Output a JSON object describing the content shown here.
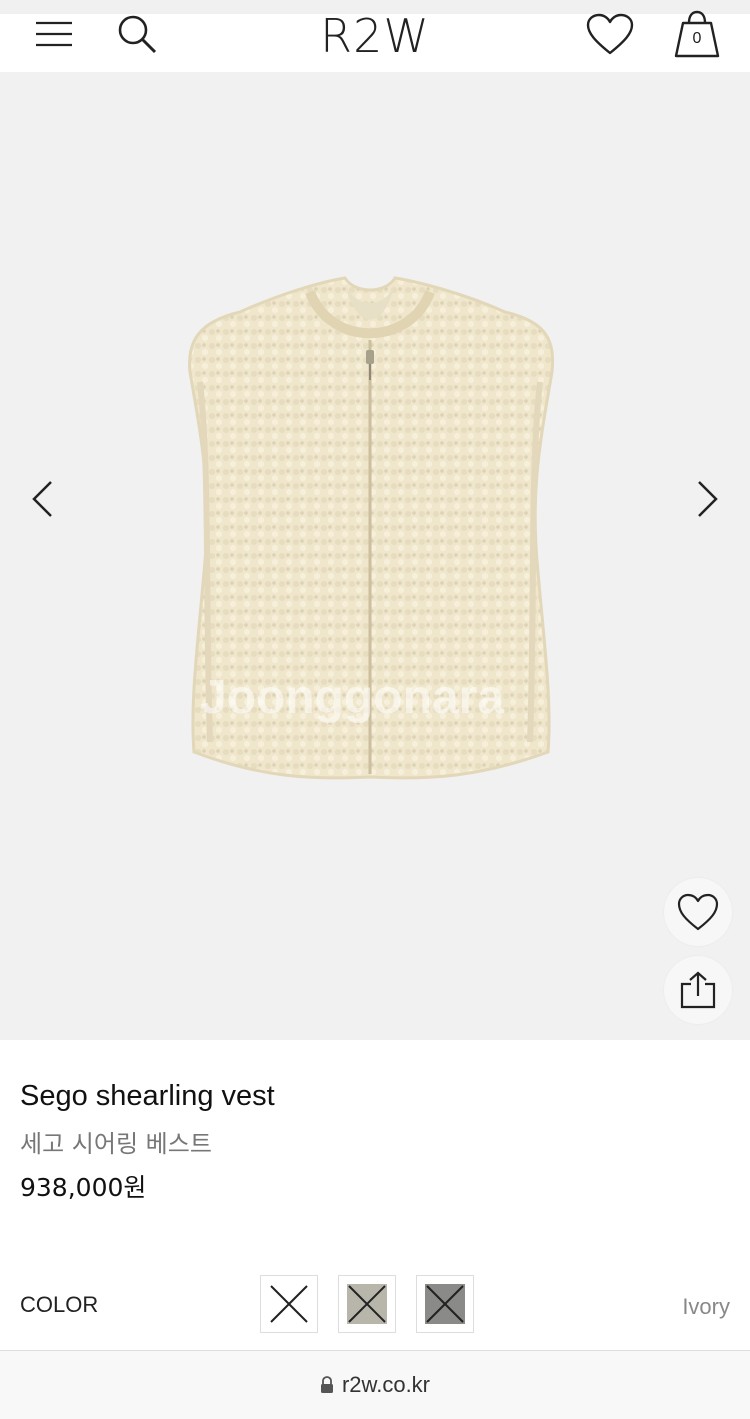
{
  "header": {
    "logo": "R2W",
    "bag_count": "0",
    "icons": {
      "menu": "hamburger-icon",
      "search": "search-icon",
      "wishlist": "heart-icon",
      "bag": "shopping-bag-icon"
    }
  },
  "gallery": {
    "watermark": "Joonggonara",
    "icons": {
      "prev": "chevron-left-icon",
      "next": "chevron-right-icon",
      "favorite": "heart-icon",
      "share": "share-icon"
    }
  },
  "product": {
    "name": "Sego shearling vest",
    "name_ko": "세고 시어링 베스트",
    "price": "938,000원"
  },
  "color": {
    "label": "COLOR",
    "selected": "Ivory",
    "swatches": [
      {
        "color": "#ffffff"
      },
      {
        "color": "#b8b6ab"
      },
      {
        "color": "#8a8a88"
      }
    ]
  },
  "browser": {
    "url": "r2w.co.kr",
    "icons": {
      "lock": "lock-icon"
    }
  },
  "colors": {
    "background_gallery": "#f1f1f1",
    "product_fur": "#efe6cc",
    "text_primary": "#111111",
    "text_secondary": "#777777"
  }
}
